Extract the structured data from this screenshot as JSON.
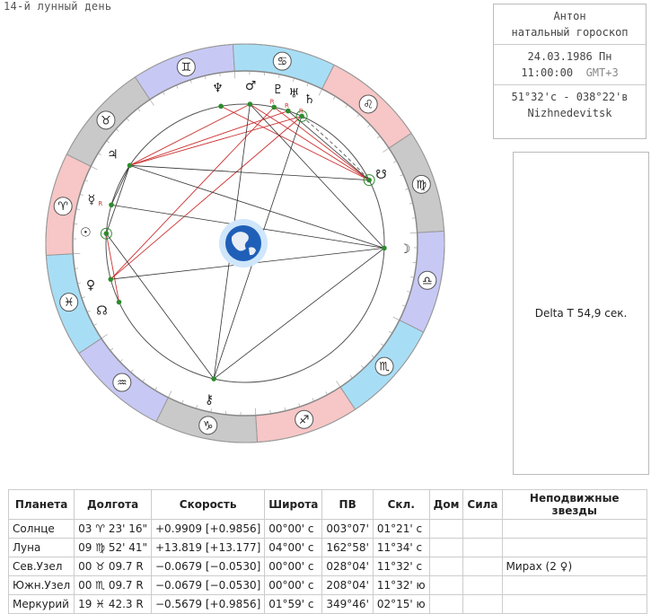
{
  "lunar_day": "14-й лунный день",
  "info": {
    "name": "Антон",
    "chart_type": "натальный гороскоп",
    "date": "24.03.1986 Пн",
    "time": "11:00:00",
    "gmt": "GMT+3",
    "coords": "51°32'с - 038°22'в",
    "place": "Nizhnedevitsk"
  },
  "delta_t": "Delta T   54,9 сек.",
  "colors": {
    "fire": "#f7c6c6",
    "earth": "#c9c9c9",
    "air": "#c8c8f5",
    "water": "#a8def5",
    "aspect_red": "#cc3333",
    "aspect_dark": "#333333",
    "planet_dot": "#2e8b2e"
  },
  "zodiac_signs": [
    {
      "name": "aries",
      "glyph": "♈"
    },
    {
      "name": "taurus",
      "glyph": "♉"
    },
    {
      "name": "gemini",
      "glyph": "♊"
    },
    {
      "name": "cancer",
      "glyph": "♋"
    },
    {
      "name": "leo",
      "glyph": "♌"
    },
    {
      "name": "virgo",
      "glyph": "♍"
    },
    {
      "name": "libra",
      "glyph": "♎"
    },
    {
      "name": "scorpio",
      "glyph": "♏"
    },
    {
      "name": "sagittarius",
      "glyph": "♐"
    },
    {
      "name": "capricorn",
      "glyph": "♑"
    },
    {
      "name": "aquarius",
      "glyph": "♒"
    },
    {
      "name": "pisces",
      "glyph": "♓"
    }
  ],
  "planets": [
    {
      "name": "sun",
      "glyph": "☉",
      "retro": ""
    },
    {
      "name": "moon",
      "glyph": "☽",
      "retro": ""
    },
    {
      "name": "mercury",
      "glyph": "☿",
      "retro": "R"
    },
    {
      "name": "venus",
      "glyph": "♀",
      "retro": ""
    },
    {
      "name": "mars",
      "glyph": "♂",
      "retro": ""
    },
    {
      "name": "jupiter",
      "glyph": "♃",
      "retro": ""
    },
    {
      "name": "saturn",
      "glyph": "♄",
      "retro": "R"
    },
    {
      "name": "uranus",
      "glyph": "♅",
      "retro": "R"
    },
    {
      "name": "neptune",
      "glyph": "♆",
      "retro": ""
    },
    {
      "name": "pluto",
      "glyph": "♇",
      "retro": "R"
    },
    {
      "name": "north_node",
      "glyph": "☊",
      "retro": ""
    },
    {
      "name": "south_node",
      "glyph": "☋",
      "retro": ""
    },
    {
      "name": "chiron",
      "glyph": "⚷",
      "retro": ""
    }
  ],
  "table": {
    "headers": [
      "Планета",
      "Долгота",
      "Скорость",
      "Широта",
      "ПВ",
      "Скл.",
      "Дом",
      "Сила",
      "Неподвижные звезды"
    ],
    "rows": [
      [
        "Солнце",
        "03 ♈ 23' 16\"",
        "+0.9909 [+0.9856]",
        "00°00' с",
        "003°07'",
        "01°21' с",
        "",
        "",
        ""
      ],
      [
        "Луна",
        "09 ♍ 52' 41\"",
        "+13.819 [+13.177]",
        "04°00' с",
        "162°58'",
        "11°34' с",
        "",
        "",
        ""
      ],
      [
        "Сев.Узел",
        "00 ♉ 09.7  R",
        "−0.0679 [−0.0530]",
        "00°00' с",
        "028°04'",
        "11°32' с",
        "",
        "",
        "Мирах (2 ♀)"
      ],
      [
        "Южн.Узел",
        "00 ♏ 09.7  R",
        "−0.0679 [−0.0530]",
        "00°00' с",
        "208°04'",
        "11°32' ю",
        "",
        "",
        ""
      ],
      [
        "Меркурий",
        "19 ♓ 42.3  R",
        "−0.5679 [+0.9856]",
        "01°59' с",
        "349°46'",
        "02°15' ю",
        "",
        "",
        ""
      ]
    ]
  }
}
